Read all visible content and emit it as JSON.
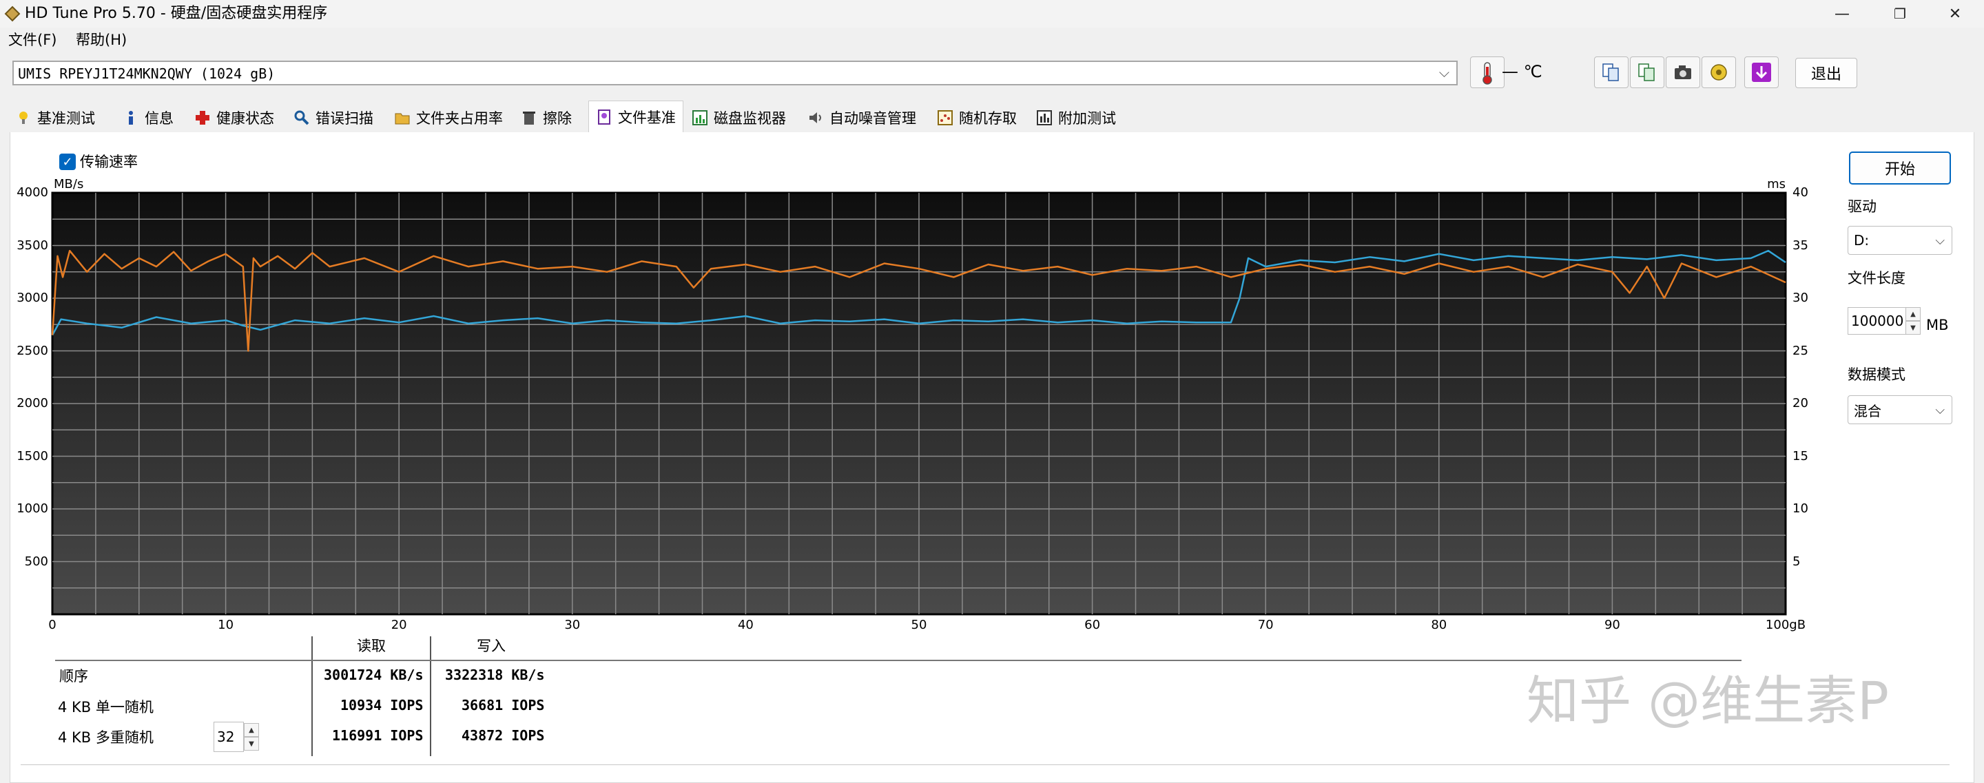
{
  "window": {
    "title": "HD Tune Pro 5.70 - 硬盘/固态硬盘实用程序",
    "minimize_glyph": "—",
    "maximize_glyph": "❐",
    "close_glyph": "✕"
  },
  "menu": {
    "file": "文件(F)",
    "help": "帮助(H)"
  },
  "drive": {
    "selected": "UMIS RPEYJ1T24MKN2QWY (1024 gB)",
    "temperature": "— ℃",
    "exit_label": "退出",
    "toolbar_icons": [
      "copy-info-icon",
      "copy-text-icon",
      "camera-icon",
      "options-icon",
      "save-down-icon"
    ]
  },
  "tabs": [
    {
      "label": "基准测试",
      "icon": "benchmark-icon"
    },
    {
      "label": "信息",
      "icon": "info-icon"
    },
    {
      "label": "健康状态",
      "icon": "health-icon"
    },
    {
      "label": "错误扫描",
      "icon": "error-scan-icon"
    },
    {
      "label": "文件夹占用率",
      "icon": "folder-usage-icon"
    },
    {
      "label": "擦除",
      "icon": "erase-icon"
    },
    {
      "label": "文件基准",
      "icon": "file-benchmark-icon",
      "active": true
    },
    {
      "label": "磁盘监视器",
      "icon": "disk-monitor-icon"
    },
    {
      "label": "自动噪音管理",
      "icon": "aam-icon"
    },
    {
      "label": "随机存取",
      "icon": "random-access-icon"
    },
    {
      "label": "附加测试",
      "icon": "extra-tests-icon"
    }
  ],
  "options": {
    "transfer_rate_label": "传输速率",
    "transfer_rate_checked": true
  },
  "right_panel": {
    "start_label": "开始",
    "drive_label": "驱动",
    "drive_value": "D:",
    "file_length_label": "文件长度",
    "file_length_value": "100000",
    "file_length_unit": "MB",
    "data_mode_label": "数据模式",
    "data_mode_value": "混合"
  },
  "results": {
    "read_header": "读取",
    "write_header": "写入",
    "rows": [
      {
        "label": "顺序",
        "read": "3001724 KB/s",
        "write": "3322318 KB/s"
      },
      {
        "label": "4 KB 单一随机",
        "read": "10934 IOPS",
        "write": "36681 IOPS"
      },
      {
        "label": "4 KB 多重随机",
        "read": "116991 IOPS",
        "write": "43872 IOPS",
        "queue_depth": "32"
      }
    ]
  },
  "watermark": "知乎 @维生素P",
  "chart_data": {
    "type": "line",
    "left_unit": "MB/s",
    "right_unit": "ms",
    "x_unit": "gB",
    "xlim": [
      0,
      100
    ],
    "ylim_left": [
      0,
      4000
    ],
    "ylim_right": [
      0,
      40
    ],
    "x_ticks": [
      "0",
      "10",
      "20",
      "30",
      "40",
      "50",
      "60",
      "70",
      "80",
      "90",
      "100gB"
    ],
    "y_left_ticks": [
      "4000",
      "3500",
      "3000",
      "2500",
      "2000",
      "1500",
      "1000",
      "500"
    ],
    "y_right_ticks": [
      "40",
      "35",
      "30",
      "25",
      "20",
      "15",
      "10",
      "5"
    ],
    "grid": true,
    "colors": {
      "read": "#33a6d8",
      "write": "#e57c24",
      "background_top": "#0e0e0e",
      "background_bottom": "#4a4a4a"
    },
    "series": [
      {
        "color_key": "read",
        "x": [
          0,
          0.5,
          2,
          4,
          6,
          8,
          10,
          11,
          12,
          14,
          16,
          18,
          20,
          22,
          24,
          26,
          28,
          30,
          32,
          34,
          36,
          38,
          40,
          42,
          44,
          46,
          48,
          50,
          52,
          54,
          56,
          58,
          60,
          62,
          64,
          66,
          68,
          68.5,
          69,
          70,
          72,
          74,
          76,
          78,
          80,
          82,
          84,
          86,
          88,
          90,
          92,
          94,
          96,
          98,
          99,
          100
        ],
        "values": [
          2650,
          2800,
          2760,
          2720,
          2820,
          2760,
          2790,
          2740,
          2700,
          2790,
          2760,
          2810,
          2770,
          2830,
          2760,
          2790,
          2810,
          2760,
          2790,
          2770,
          2760,
          2790,
          2830,
          2760,
          2790,
          2780,
          2800,
          2760,
          2790,
          2780,
          2800,
          2770,
          2790,
          2760,
          2780,
          2770,
          2770,
          3000,
          3380,
          3300,
          3360,
          3340,
          3390,
          3350,
          3420,
          3360,
          3400,
          3380,
          3360,
          3390,
          3370,
          3410,
          3360,
          3380,
          3450,
          3340
        ]
      },
      {
        "color_key": "write",
        "x": [
          0,
          0.3,
          0.6,
          1,
          2,
          3,
          4,
          5,
          6,
          7,
          8,
          9,
          10,
          11,
          11.3,
          11.6,
          12,
          13,
          14,
          15,
          16,
          18,
          20,
          22,
          24,
          26,
          28,
          30,
          32,
          34,
          36,
          37,
          38,
          40,
          42,
          44,
          46,
          48,
          50,
          52,
          54,
          56,
          58,
          60,
          62,
          64,
          66,
          68,
          70,
          72,
          74,
          76,
          78,
          80,
          82,
          84,
          86,
          88,
          90,
          91,
          92,
          93,
          94,
          96,
          98,
          100
        ],
        "values": [
          2650,
          3400,
          3200,
          3450,
          3250,
          3420,
          3280,
          3380,
          3300,
          3440,
          3260,
          3350,
          3420,
          3300,
          2500,
          3380,
          3300,
          3400,
          3280,
          3430,
          3300,
          3380,
          3250,
          3400,
          3300,
          3350,
          3280,
          3300,
          3250,
          3350,
          3300,
          3100,
          3280,
          3320,
          3250,
          3300,
          3200,
          3330,
          3280,
          3200,
          3320,
          3260,
          3300,
          3220,
          3280,
          3260,
          3300,
          3200,
          3280,
          3320,
          3250,
          3300,
          3230,
          3330,
          3250,
          3300,
          3200,
          3320,
          3250,
          3050,
          3300,
          3000,
          3330,
          3200,
          3300,
          3150
        ]
      }
    ]
  }
}
